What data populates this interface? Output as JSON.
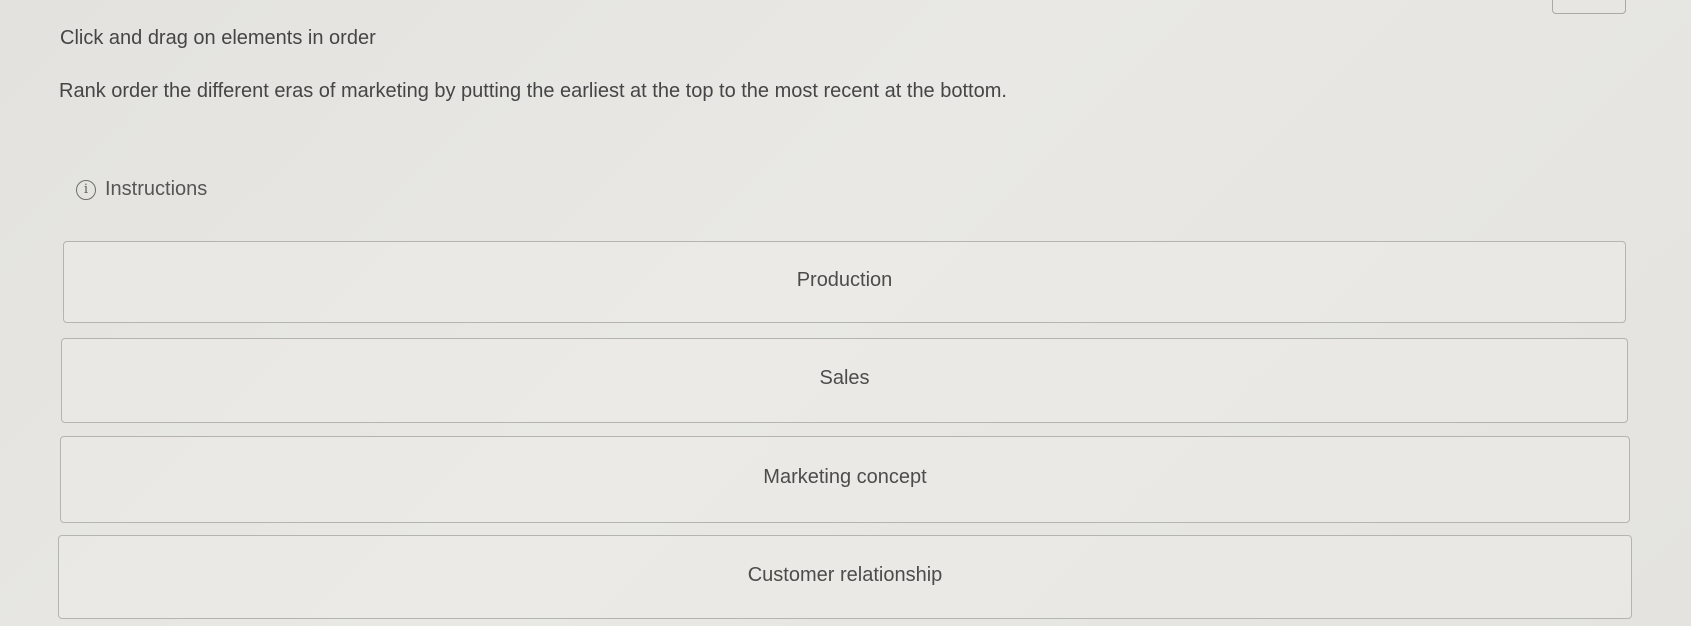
{
  "prompt": {
    "title": "Click and drag on elements in order",
    "question": "Rank order the different eras of marketing by putting the earliest at the top to the most recent at the bottom."
  },
  "instructions": {
    "label": "Instructions",
    "icon": "info-icon"
  },
  "rank_items": [
    {
      "label": "Production"
    },
    {
      "label": "Sales"
    },
    {
      "label": "Marketing concept"
    },
    {
      "label": "Customer relationship"
    }
  ]
}
